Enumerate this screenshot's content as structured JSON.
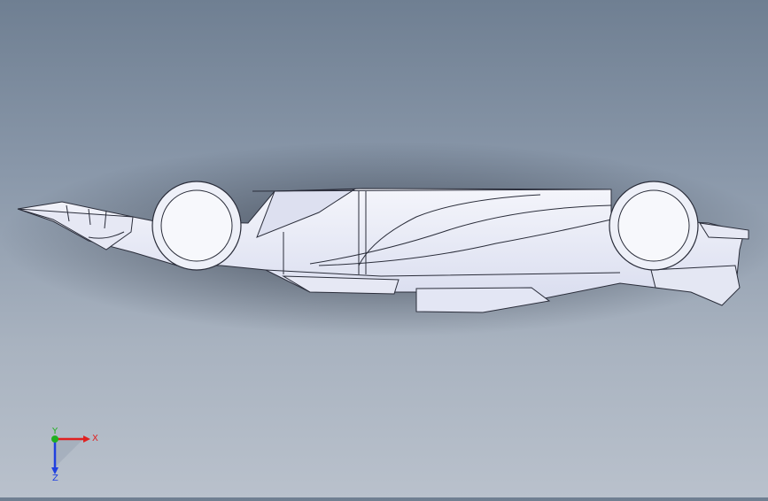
{
  "viewport": {
    "model": "f1-car-side-view",
    "background_top": "#6f7f92",
    "background_bottom": "#b9c1cc",
    "body_color": "#eceef8"
  },
  "triad": {
    "x_label": "X",
    "y_label": "Y",
    "z_label": "Z",
    "x_color": "#e02020",
    "y_color": "#20b020",
    "z_color": "#2040e0"
  }
}
